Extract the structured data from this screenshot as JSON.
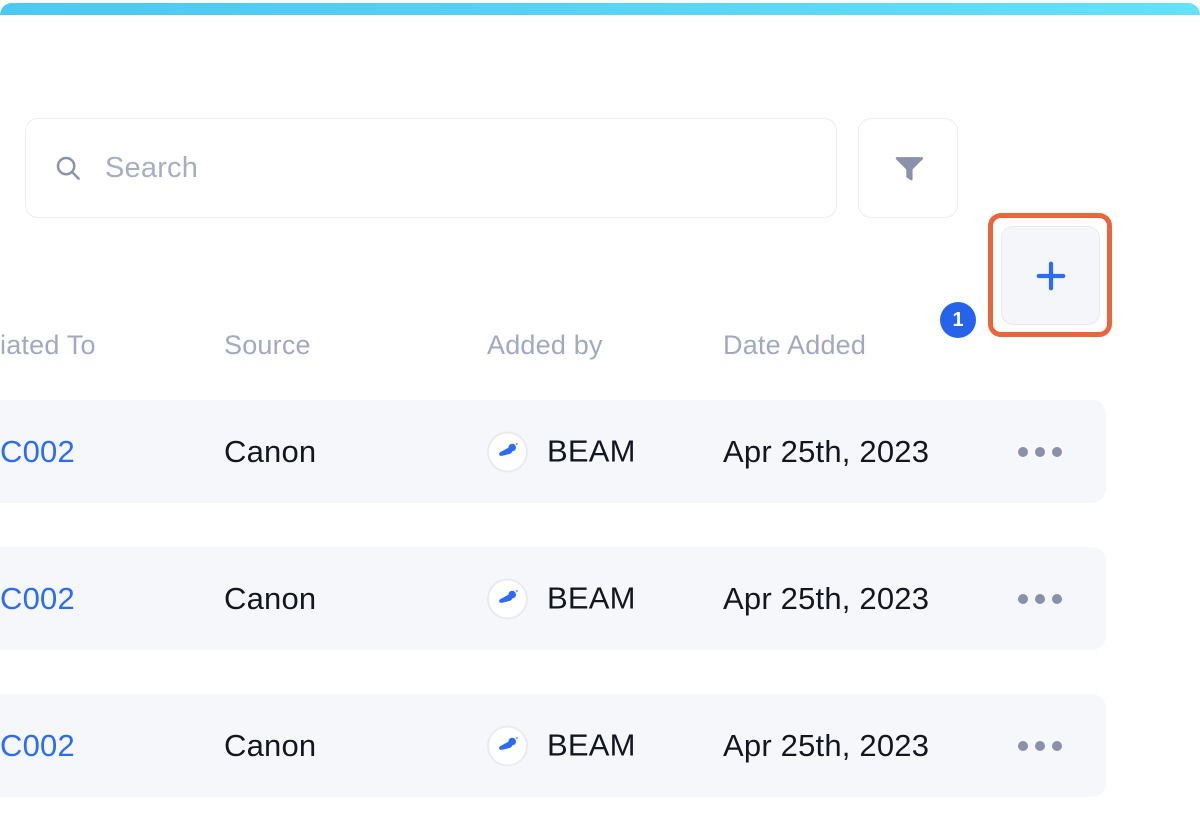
{
  "window": {
    "accent_bar_gradient_from": "#4CC9F0",
    "accent_bar_gradient_to": "#63E2FA"
  },
  "toolbar": {
    "search": {
      "icon": "search-icon",
      "value": "",
      "placeholder": "Search"
    },
    "filter": {
      "icon": "filter-icon",
      "badge_count": "1",
      "badge_color": "#2563EB"
    },
    "add": {
      "icon": "plus-icon",
      "highlighted": true,
      "highlight_color": "#E9663C"
    }
  },
  "table": {
    "columns": [
      {
        "key": "associated_to",
        "label": "iated To"
      },
      {
        "key": "source",
        "label": "Source"
      },
      {
        "key": "added_by",
        "label": "Added by"
      },
      {
        "key": "date_added",
        "label": "Date Added"
      }
    ],
    "rows": [
      {
        "associated_to": "C002",
        "source": "Canon",
        "added_by": "BEAM",
        "added_by_avatar": "beam-logo-icon",
        "date_added": "Apr 25th, 2023",
        "menu": "more-options-icon"
      },
      {
        "associated_to": "C002",
        "source": "Canon",
        "added_by": "BEAM",
        "added_by_avatar": "beam-logo-icon",
        "date_added": "Apr 25th, 2023",
        "menu": "more-options-icon"
      },
      {
        "associated_to": "C002",
        "source": "Canon",
        "added_by": "BEAM",
        "added_by_avatar": "beam-logo-icon",
        "date_added": "Apr 25th, 2023",
        "menu": "more-options-icon"
      }
    ]
  }
}
